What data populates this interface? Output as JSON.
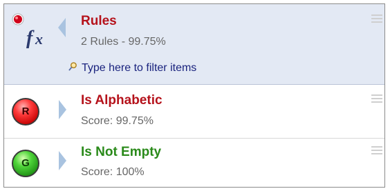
{
  "header": {
    "title": "Rules",
    "subtitle": "2 Rules - 99.75%",
    "filter_placeholder": "Type here to filter items",
    "icon": "fx-function-icon",
    "badge_color": "#d0021b"
  },
  "rules": [
    {
      "letter": "R",
      "name": "Is Alphabetic",
      "score": "Score: 99.75%",
      "color": "#b5121b",
      "ball": "red"
    },
    {
      "letter": "G",
      "name": "Is Not Empty",
      "score": "Score: 100%",
      "color": "#2a8a1a",
      "ball": "green"
    }
  ]
}
